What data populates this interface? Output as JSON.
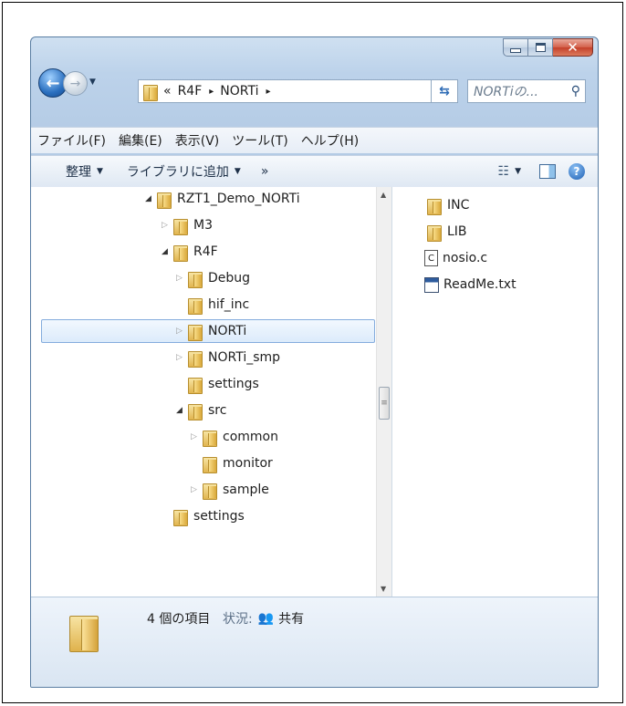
{
  "window": {
    "address": {
      "overflow": "«",
      "crumbs": [
        "R4F",
        "NORTi"
      ],
      "separator": "▸",
      "dropdown": "▾"
    },
    "search_placeholder": "NORTiの...",
    "menu": [
      "ファイル(F)",
      "編集(E)",
      "表示(V)",
      "ツール(T)",
      "ヘルプ(H)"
    ],
    "toolbar": {
      "organize": "整理",
      "add_to_library": "ライブラリに追加",
      "more": "»"
    },
    "tree": [
      {
        "label": "RZT1_Demo_NORTi",
        "state": "expanded"
      },
      {
        "label": "M3",
        "state": "collapsed"
      },
      {
        "label": "R4F",
        "state": "expanded"
      },
      {
        "label": "Debug",
        "state": "collapsed"
      },
      {
        "label": "hif_inc",
        "state": "none"
      },
      {
        "label": "NORTi",
        "state": "collapsed",
        "selected": true
      },
      {
        "label": "NORTi_smp",
        "state": "collapsed"
      },
      {
        "label": "settings",
        "state": "none"
      },
      {
        "label": "src",
        "state": "expanded"
      },
      {
        "label": "common",
        "state": "collapsed"
      },
      {
        "label": "monitor",
        "state": "none"
      },
      {
        "label": "sample",
        "state": "collapsed"
      },
      {
        "label": "settings",
        "state": "none"
      }
    ],
    "files": [
      {
        "name": "INC",
        "icon": "folder-icon"
      },
      {
        "name": "LIB",
        "icon": "folder-icon"
      },
      {
        "name": "nosio.c",
        "icon": "c-file-icon"
      },
      {
        "name": "ReadMe.txt",
        "icon": "text-file-icon"
      }
    ],
    "details": {
      "count": "4 個の項目",
      "status_label": "状況:",
      "status_value": "共有"
    }
  },
  "colors": {
    "chrome": "#b9cfe8",
    "selection_border": "#84acdd",
    "close_button": "#c94a34"
  }
}
